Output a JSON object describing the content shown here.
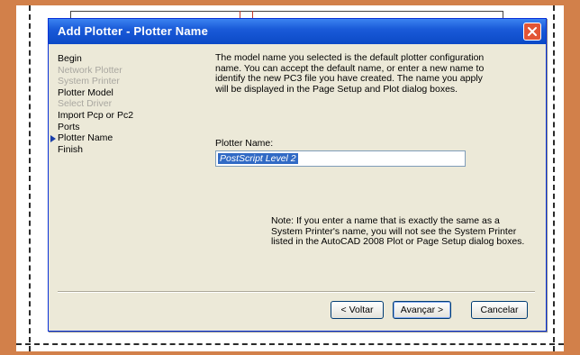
{
  "dialog": {
    "title": "Add Plotter - Plotter Name"
  },
  "steps": [
    {
      "label": "Begin",
      "state": "normal"
    },
    {
      "label": "Network Plotter",
      "state": "disabled"
    },
    {
      "label": "System Printer",
      "state": "disabled"
    },
    {
      "label": "Plotter Model",
      "state": "normal"
    },
    {
      "label": "Select Driver",
      "state": "disabled"
    },
    {
      "label": "Import Pcp or Pc2",
      "state": "normal"
    },
    {
      "label": "Ports",
      "state": "normal"
    },
    {
      "label": "Plotter Name",
      "state": "current"
    },
    {
      "label": "Finish",
      "state": "normal"
    }
  ],
  "main": {
    "description": "The model name you selected is the default plotter configuration name. You can accept the default name, or enter a new name to identify the new PC3 file you have created. The name you apply will be displayed in the Page Setup and Plot dialog boxes.",
    "plotter_name_label": "Plotter Name:",
    "plotter_name_value": "PostScript Level 2",
    "note": "Note: If you enter a name that is exactly the same as a System Printer's name, you will not see the System Printer listed in the AutoCAD 2008 Plot or Page Setup dialog boxes."
  },
  "buttons": {
    "back": "< Voltar",
    "next": "Avançar >",
    "cancel": "Cancelar"
  },
  "colors": {
    "title_bar": "#0b49c6",
    "selection": "#316ac5",
    "page_border": "#d2804a"
  }
}
